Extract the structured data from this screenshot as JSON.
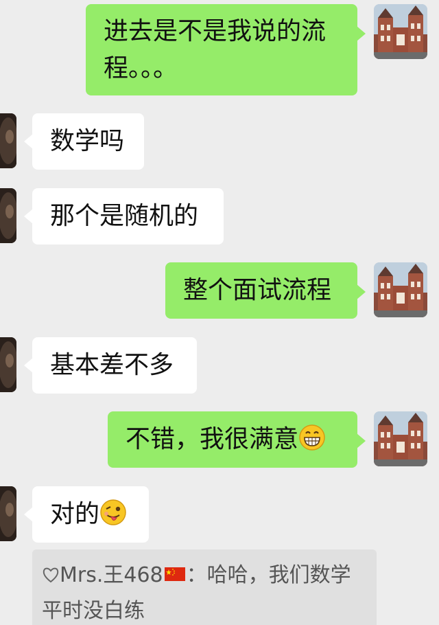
{
  "messages": [
    {
      "side": "out",
      "text": "进去是不是我说的流程。。。"
    },
    {
      "side": "in",
      "text": "数学吗"
    },
    {
      "side": "in",
      "text": "那个是随机的"
    },
    {
      "side": "out",
      "text": "整个面试流程"
    },
    {
      "side": "in",
      "text": "基本差不多"
    },
    {
      "side": "out",
      "text": "不错，我很满意",
      "emoji": "grinning-face-emoji"
    },
    {
      "side": "in",
      "text": "对的",
      "emoji": "winking-tongue-face-emoji"
    }
  ],
  "quote": {
    "sender": "Mrs.王468",
    "sender_prefix_icon": "heart-outline-icon",
    "sender_flag": "china-flag",
    "separator": "：",
    "text": "哈哈，我们数学平时没白练"
  },
  "avatars": {
    "self": "castle-building-avatar",
    "other": "dark-photo-avatar"
  },
  "colors": {
    "background": "#ededed",
    "outgoing_bubble": "#95ec69",
    "incoming_bubble": "#ffffff",
    "quote_bubble": "#e0e0e0"
  }
}
